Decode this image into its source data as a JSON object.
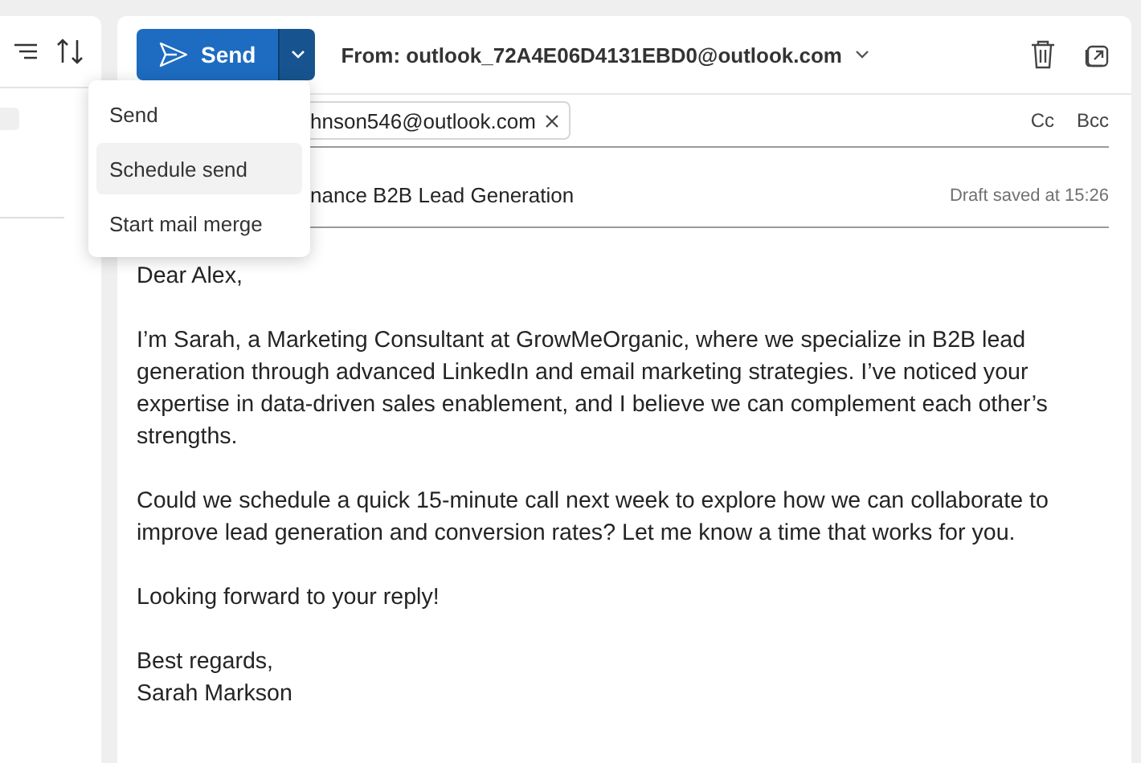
{
  "toolbar": {
    "send_label": "Send",
    "from": "From: outlook_72A4E06D4131EBD0@outlook.com"
  },
  "send_menu": [
    {
      "label": "Send",
      "selected": false
    },
    {
      "label": "Schedule send",
      "selected": true
    },
    {
      "label": "Start mail merge",
      "selected": false
    }
  ],
  "to": {
    "recipient": "hnson546@outlook.com",
    "cc": "Cc",
    "bcc": "Bcc"
  },
  "subject": {
    "value": "nance B2B Lead Generation",
    "status": "Draft saved at 15:26"
  },
  "body": [
    "Dear Alex,",
    "I’m Sarah, a Marketing Consultant at GrowMeOrganic, where we specialize in B2B lead generation through advanced LinkedIn and email marketing strategies. I’ve noticed your expertise in data-driven sales enablement, and I believe we can complement each other’s strengths.",
    "Could we schedule a quick 15-minute call next week to explore how we can collaborate to improve lead generation and conversion rates? Let me know a time that works for you.",
    "Looking forward to your reply!",
    "Best regards,\nSarah Markson"
  ]
}
